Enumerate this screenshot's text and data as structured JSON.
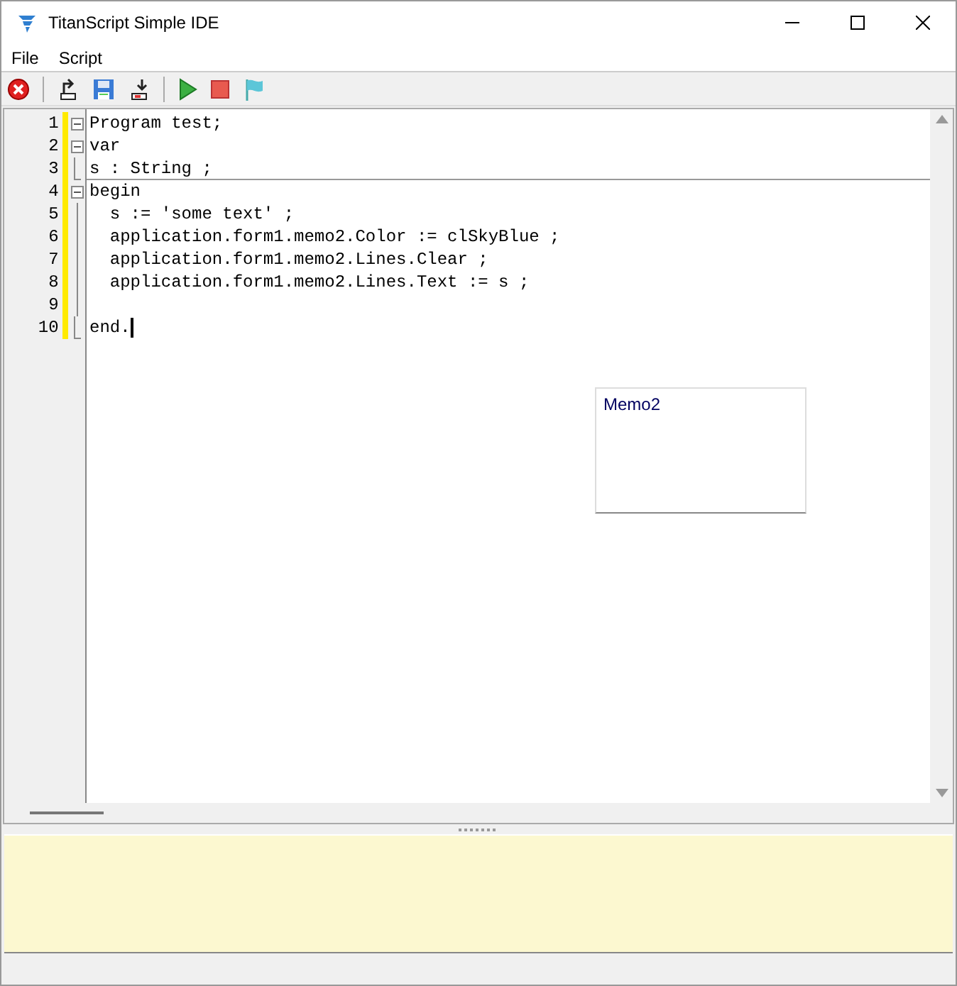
{
  "window": {
    "title": "TitanScript Simple IDE"
  },
  "menu": [
    "File",
    "Script"
  ],
  "toolbar": [
    {
      "kind": "close",
      "separator_before": false
    },
    {
      "kind": "open",
      "separator_before": true
    },
    {
      "kind": "save",
      "separator_before": false
    },
    {
      "kind": "export",
      "separator_before": false
    },
    {
      "kind": "run",
      "separator_before": true
    },
    {
      "kind": "stop",
      "separator_before": false
    },
    {
      "kind": "flag",
      "separator_before": false
    }
  ],
  "editor": {
    "lines": [
      {
        "number": "1",
        "text": "Program test;",
        "kind": "start",
        "caret": false
      },
      {
        "number": "2",
        "text": "var",
        "kind": "start",
        "caret": false
      },
      {
        "number": "3",
        "text": "s : String ;",
        "kind": "end",
        "caret": false
      },
      {
        "number": "4",
        "text": "begin",
        "kind": "start",
        "caret": false
      },
      {
        "number": "5",
        "text": "  s := 'some text' ;",
        "kind": "inside",
        "caret": false
      },
      {
        "number": "6",
        "text": "  application.form1.memo2.Color := clSkyBlue ;",
        "kind": "inside",
        "caret": false
      },
      {
        "number": "7",
        "text": "  application.form1.memo2.Lines.Clear ;",
        "kind": "inside",
        "caret": false
      },
      {
        "number": "8",
        "text": "  application.form1.memo2.Lines.Text := s ;",
        "kind": "inside",
        "caret": false
      },
      {
        "number": "9",
        "kind": "inside",
        "caret": false
      },
      {
        "number": "10",
        "text": "end.",
        "kind": "end",
        "caret": true
      }
    ]
  },
  "memo": {
    "text": "Memo2"
  }
}
